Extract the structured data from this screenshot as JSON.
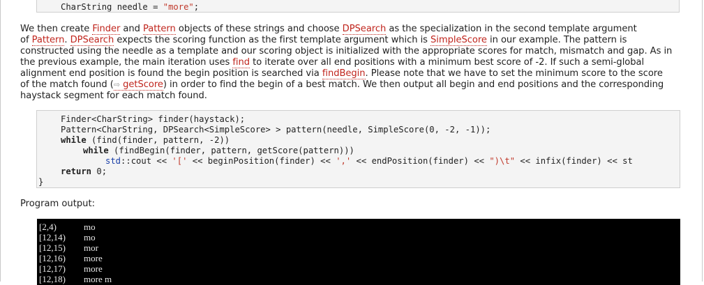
{
  "top_code": {
    "prefix": "CharString needle = ",
    "string": "\"more\"",
    "suffix": ";"
  },
  "paragraph": {
    "l1": {
      "t1": "We then create ",
      "link_finder": "Finder",
      "t2": " and ",
      "link_pattern": "Pattern",
      "t3": " objects of these strings and choose ",
      "link_dpsearch": "DPSearch",
      "t4": " as the specialization in the second template argument"
    },
    "l2": {
      "t1": "of ",
      "link_pattern": "Pattern",
      "t2": ". ",
      "link_dpsearch": "DPSearch",
      "t3": " expects the scoring function as the first template argument which is ",
      "link_simplescore": "SimpleScore",
      "t4": " in our example. The pattern is"
    },
    "l3": "constructed using the needle as a template and our scoring object is initialized with the appropriate scores for match, mismatch and gap. As in",
    "l4": {
      "t1": "the previous example, the main iteration uses ",
      "link_find": "find",
      "t2": " to iterate over all end positions with a minimum best score of -2. If such a semi-global"
    },
    "l5": {
      "t1": "alignment end position is found the begin position is searched via ",
      "link_findbegin": "findBegin",
      "t2": ". Please note that we have to set the minimum score to the score"
    },
    "l6": {
      "t1": "of the match found (",
      "arrow": "⇨",
      "link_getscore": "getScore",
      "t2": ") in order to find the begin of a best match. We then output all begin and end positions and the corresponding"
    },
    "l7": "haystack segment for each match found."
  },
  "code_main": {
    "line1": "Finder<CharString> finder(haystack);",
    "line2": "Pattern<CharString, DPSearch<SimpleScore> > pattern(needle, SimpleScore(0, -2, -1));",
    "line3_kw": "while",
    "line3_rest": " (find(finder, pattern, -2))",
    "line4_kw": "while",
    "line4_rest": " (findBegin(finder, pattern, getScore(pattern)))",
    "line5_ns": "std",
    "line5_a": "::cout << ",
    "line5_s1": "'['",
    "line5_b": " << beginPosition(finder) << ",
    "line5_s2": "','",
    "line5_c": " << endPosition(finder) << ",
    "line5_s3": "\")\\t\"",
    "line5_d": " << infix(finder) << st",
    "line6_kw": "return",
    "line6_rest": " 0;",
    "line7": "}"
  },
  "output_label": "Program output:",
  "terminal": [
    {
      "pos": "[2,4)",
      "text": "mo"
    },
    {
      "pos": "[12,14)",
      "text": "mo"
    },
    {
      "pos": "[12,15)",
      "text": "mor"
    },
    {
      "pos": "[12,16)",
      "text": "more"
    },
    {
      "pos": "[12,17)",
      "text": "more"
    },
    {
      "pos": "[12,18)",
      "text": "more m"
    }
  ]
}
